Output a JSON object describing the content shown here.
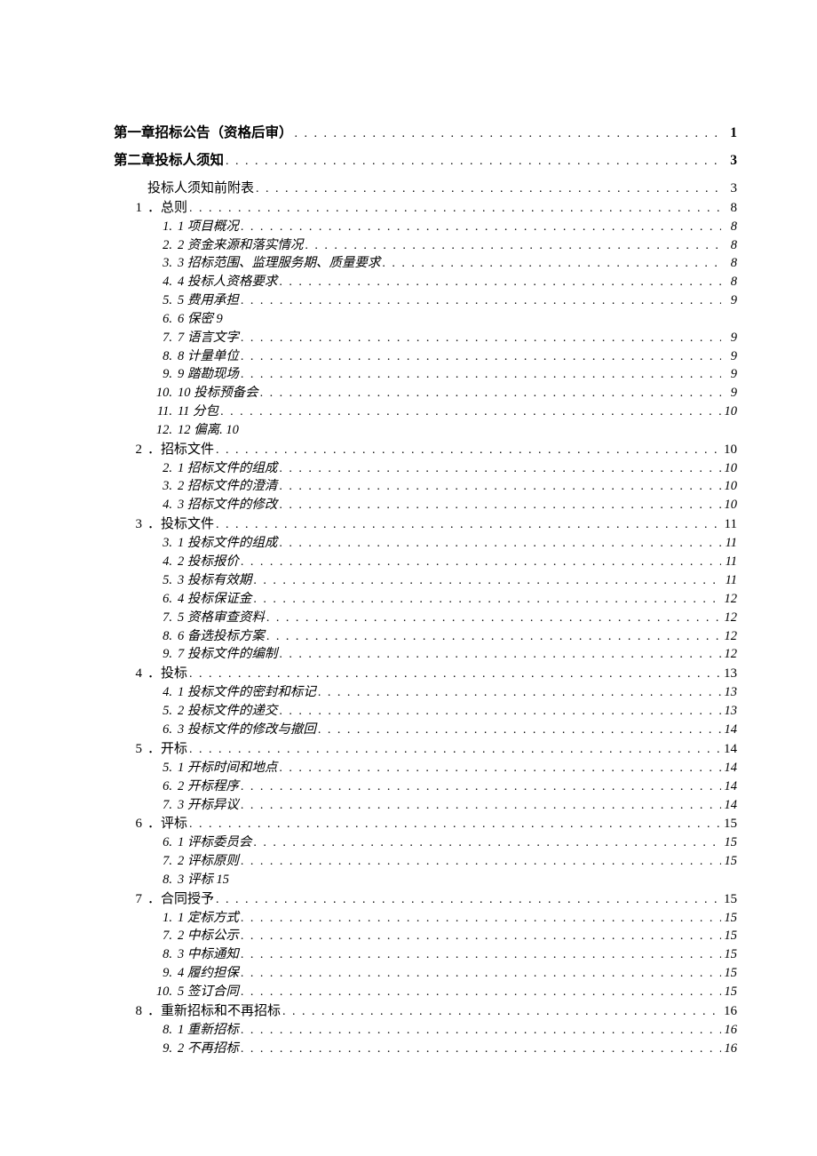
{
  "toc": [
    {
      "level": 0,
      "style": "chapter",
      "num": "",
      "title": "第一章招标公告（资格后审）",
      "page": "1",
      "dots": true
    },
    {
      "level": 0,
      "style": "chapter",
      "num": "",
      "title": "第二章投标人须知",
      "page": "3",
      "dots": true
    },
    {
      "level": 1,
      "style": "section",
      "num": "",
      "title": "投标人须知前附表",
      "page": "3",
      "dots": true
    },
    {
      "level": 1,
      "style": "section",
      "num": "1",
      "title": "．总则",
      "page": "8",
      "dots": true
    },
    {
      "level": 2,
      "style": "sub",
      "num": "1.",
      "title": "1 项目概况",
      "page": "8",
      "dots": true
    },
    {
      "level": 2,
      "style": "sub",
      "num": "2.",
      "title": "2 资金来源和落实情况",
      "page": "8",
      "dots": true
    },
    {
      "level": 2,
      "style": "sub",
      "num": "3.",
      "title": "3 招标范围、监理服务期、质量要求",
      "page": "8",
      "dots": true
    },
    {
      "level": 2,
      "style": "sub",
      "num": "4.",
      "title": "4 投标人资格要求",
      "page": "8",
      "dots": true
    },
    {
      "level": 2,
      "style": "sub",
      "num": "5.",
      "title": "5 费用承担",
      "page": "9",
      "dots": true
    },
    {
      "level": 2,
      "style": "sub",
      "num": "6.",
      "title": "6 保密   9",
      "page": "",
      "dots": false
    },
    {
      "level": 2,
      "style": "sub",
      "num": "7.",
      "title": "7 语言文字",
      "page": "9",
      "dots": true
    },
    {
      "level": 2,
      "style": "sub",
      "num": "8.",
      "title": "8 计量单位",
      "page": "9",
      "dots": true
    },
    {
      "level": 2,
      "style": "sub",
      "num": "9.",
      "title": "9 踏勘现场",
      "page": "9",
      "dots": true
    },
    {
      "level": 2,
      "style": "sub",
      "num": "10.",
      "title": "10 投标预备会",
      "page": "9",
      "dots": true
    },
    {
      "level": 2,
      "style": "sub",
      "num": "11.",
      "title": "          11 分包",
      "page": "10",
      "dots": true
    },
    {
      "level": 2,
      "style": "sub",
      "num": "12.",
      "title": "12 偏离. 10",
      "page": "",
      "dots": false
    },
    {
      "level": 1,
      "style": "section",
      "num": "2",
      "title": "．招标文件",
      "page": "10",
      "dots": true
    },
    {
      "level": 2,
      "style": "sub",
      "num": "2.",
      "title": "1 招标文件的组成",
      "page": "10",
      "dots": true
    },
    {
      "level": 2,
      "style": "sub",
      "num": "3.",
      "title": "2 招标文件的澄清",
      "page": "10",
      "dots": true
    },
    {
      "level": 2,
      "style": "sub",
      "num": "4.",
      "title": "3 招标文件的修改",
      "page": "10",
      "dots": true
    },
    {
      "level": 1,
      "style": "section",
      "num": "3",
      "title": "．投标文件",
      "page": "11",
      "dots": true
    },
    {
      "level": 2,
      "style": "sub",
      "num": "3.",
      "title": "1 投标文件的组成",
      "page": "11",
      "dots": true
    },
    {
      "level": 2,
      "style": "sub",
      "num": "4.",
      "title": "2 投标报价",
      "page": "11",
      "dots": true
    },
    {
      "level": 2,
      "style": "sub",
      "num": "5.",
      "title": "3 投标有效期",
      "page": "11",
      "dots": true
    },
    {
      "level": 2,
      "style": "sub",
      "num": "6.",
      "title": "4 投标保证金",
      "page": "12",
      "dots": true
    },
    {
      "level": 2,
      "style": "sub",
      "num": "7.",
      "title": "5 资格审查资料",
      "page": "12",
      "dots": true
    },
    {
      "level": 2,
      "style": "sub",
      "num": "8.",
      "title": "6 备选投标方案",
      "page": "12",
      "dots": true
    },
    {
      "level": 2,
      "style": "sub",
      "num": "9.",
      "title": "7 投标文件的编制",
      "page": "12",
      "dots": true
    },
    {
      "level": 1,
      "style": "section",
      "num": "4",
      "title": "．投标",
      "page": "13",
      "dots": true
    },
    {
      "level": 2,
      "style": "sub",
      "num": "4.",
      "title": "1 投标文件的密封和标记",
      "page": "13",
      "dots": true
    },
    {
      "level": 2,
      "style": "sub",
      "num": "5.",
      "title": "2 投标文件的递交",
      "page": "13",
      "dots": true
    },
    {
      "level": 2,
      "style": "sub",
      "num": "6.",
      "title": "3 投标文件的修改与撤回",
      "page": "14",
      "dots": true
    },
    {
      "level": 1,
      "style": "section",
      "num": "5",
      "title": "．开标",
      "page": "14",
      "dots": true
    },
    {
      "level": 2,
      "style": "sub",
      "num": "5.",
      "title": "1 开标时间和地点",
      "page": "14",
      "dots": true
    },
    {
      "level": 2,
      "style": "sub",
      "num": "6.",
      "title": "2 开标程序",
      "page": "14",
      "dots": true
    },
    {
      "level": 2,
      "style": "sub",
      "num": "7.",
      "title": "3 开标异议",
      "page": "14",
      "dots": true
    },
    {
      "level": 1,
      "style": "section",
      "num": "6",
      "title": "．评标",
      "page": "15",
      "dots": true
    },
    {
      "level": 2,
      "style": "sub",
      "num": "6.",
      "title": "1 评标委员会",
      "page": "15",
      "dots": true
    },
    {
      "level": 2,
      "style": "sub",
      "num": "7.",
      "title": "2 评标原则",
      "page": "15",
      "dots": true
    },
    {
      "level": 2,
      "style": "sub",
      "num": "8.",
      "title": "3 评标   15",
      "page": "",
      "dots": false
    },
    {
      "level": 1,
      "style": "section",
      "num": "7",
      "title": "．合同授予",
      "page": "15",
      "dots": true
    },
    {
      "level": 2,
      "style": "sub",
      "num": "1.",
      "title": "1 定标方式",
      "page": "15",
      "dots": true
    },
    {
      "level": 2,
      "style": "sub",
      "num": "7.",
      "title": "2 中标公示",
      "page": "15",
      "dots": true
    },
    {
      "level": 2,
      "style": "sub",
      "num": "8.",
      "title": "3 中标通知",
      "page": "15",
      "dots": true
    },
    {
      "level": 2,
      "style": "sub",
      "num": "9.",
      "title": "4 履约担保",
      "page": "15",
      "dots": true
    },
    {
      "level": 2,
      "style": "sub",
      "num": "10.",
      "title": "5 签订合同",
      "page": "15",
      "dots": true
    },
    {
      "level": 1,
      "style": "section",
      "num": "8",
      "title": "．重新招标和不再招标",
      "page": "16",
      "dots": true
    },
    {
      "level": 2,
      "style": "sub",
      "num": "8.",
      "title": "1 重新招标",
      "page": "16",
      "dots": true
    },
    {
      "level": 2,
      "style": "sub",
      "num": "9.",
      "title": "2 不再招标",
      "page": "16",
      "dots": true
    }
  ]
}
